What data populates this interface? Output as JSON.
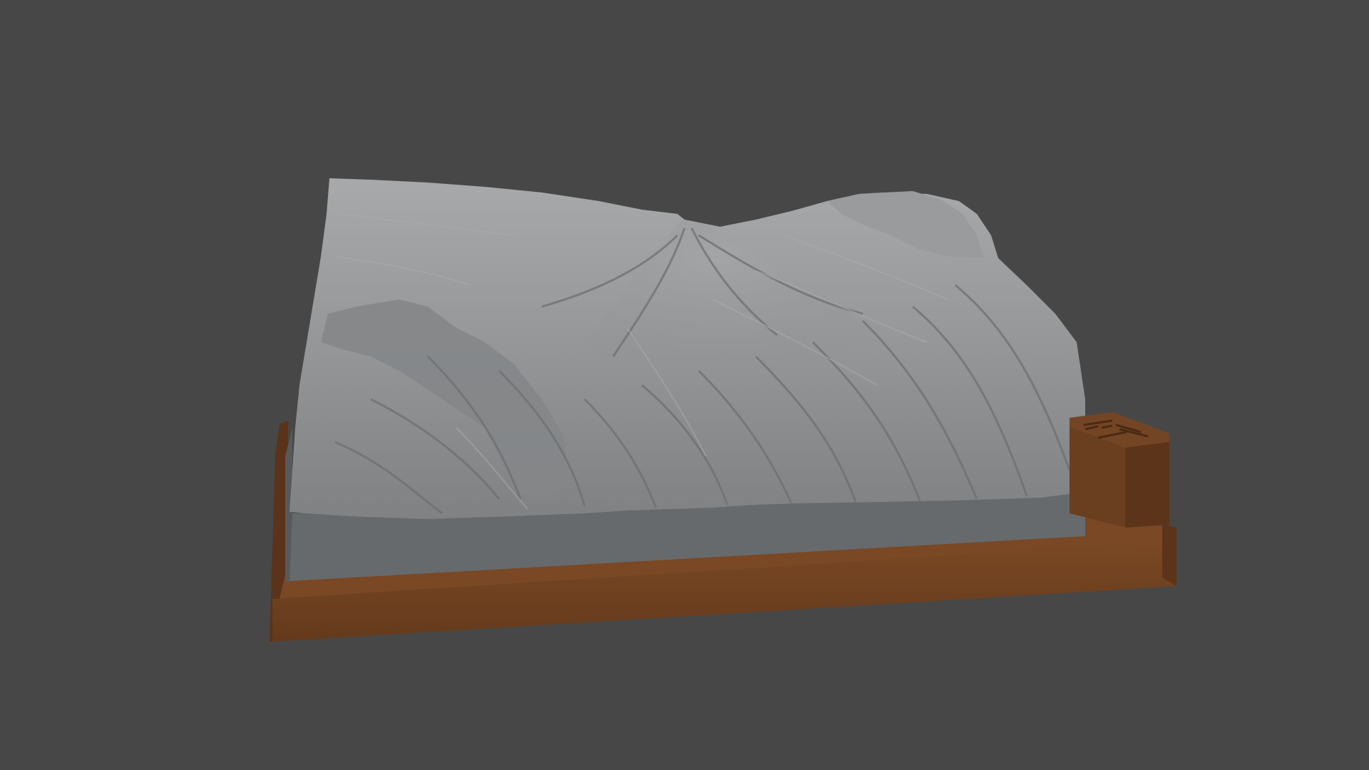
{
  "scene": {
    "background_color": "#474747",
    "terrain_color": "#8e9092",
    "terrain_shadow_color": "#5f6163",
    "terrain_highlight_color": "#b4b6b8",
    "base_slab_color": "#6b6d6f",
    "frame_color": "#6b3f1f",
    "frame_dark_color": "#51301a",
    "frame_light_color": "#7b4a26",
    "label_block_color": "#6e4121"
  }
}
